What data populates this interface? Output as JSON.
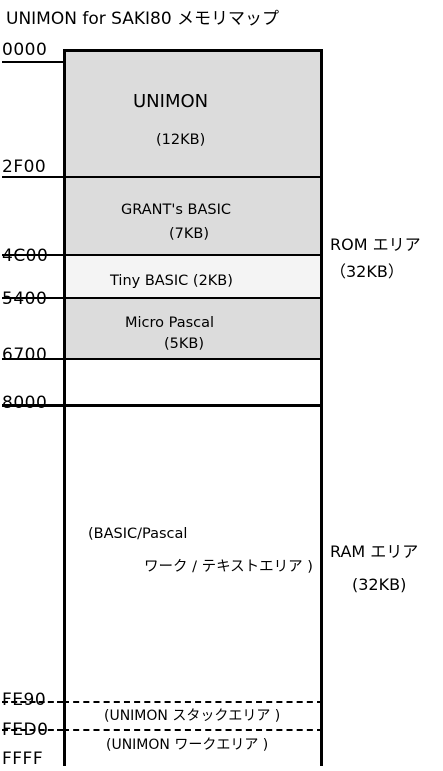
{
  "title": "UNIMON for SAKI80 メモリマップ",
  "addresses": {
    "a0000": "0000",
    "a2F00": "2F00",
    "a4C00": "4C00",
    "a5400": "5400",
    "a6700": "6700",
    "a8000": "8000",
    "aFE90": "FE90",
    "aFED0": "FED0",
    "aFFFF": "FFFF"
  },
  "rom_blocks": {
    "unimon": {
      "name": "UNIMON",
      "size": "(12KB)"
    },
    "grant_basic": {
      "name": "GRANT's BASIC",
      "size": "(7KB)"
    },
    "tiny_basic": {
      "name": "Tiny BASIC",
      "size": "(2KB)"
    },
    "micro_pascal": {
      "name": "Micro Pascal",
      "size": "(5KB)"
    }
  },
  "ram_blocks": {
    "work_text_line1": "(BASIC/Pascal",
    "work_text_line2": "ワーク / テキストエリア )",
    "unimon_stack": "(UNIMON スタックエリア )",
    "unimon_work": "(UNIMON ワークエリア )"
  },
  "areas": {
    "rom": {
      "name": "ROM エリア",
      "size": "（32KB）"
    },
    "ram": {
      "name": "RAM エリア",
      "size": "(32KB)"
    }
  },
  "colors": {
    "rom_fill": "#dcdcdc",
    "tiny_basic_fill": "#f4f4f4",
    "line": "#000000"
  }
}
